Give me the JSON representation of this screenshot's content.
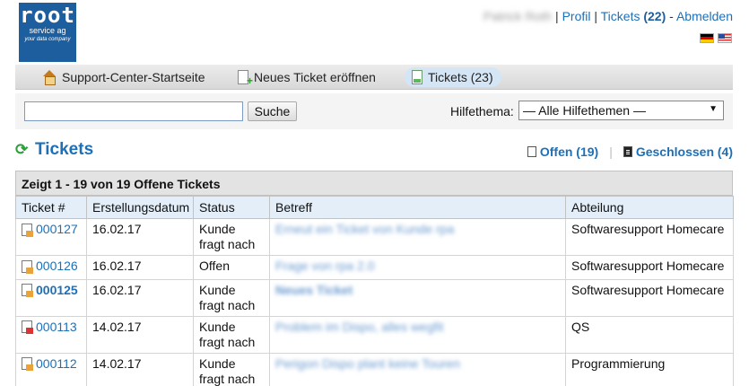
{
  "logo": {
    "line1": "root",
    "line2": "service ag",
    "line3": "your data company"
  },
  "header": {
    "user_name": "Patrick Roth",
    "separator": "|",
    "profile_label": "Profil",
    "tickets_label": "Tickets",
    "tickets_count": "(22)",
    "dash": "-",
    "logout_label": "Abmelden",
    "flags": [
      "flag-de",
      "flag-us"
    ]
  },
  "nav": {
    "tabs": [
      {
        "label": "Support-Center-Startseite",
        "icon": "home-icon"
      },
      {
        "label": "Neues Ticket eröffnen",
        "icon": "new-ticket-icon"
      },
      {
        "label": "Tickets (23)",
        "icon": "tickets-icon",
        "active": true
      }
    ]
  },
  "search": {
    "value": "",
    "button_label": "Suche",
    "help_topic_label": "Hilfethema:",
    "help_topic_value": "— Alle Hilfethemen —"
  },
  "page": {
    "title": "Tickets",
    "open_label": "Offen (19)",
    "closed_label": "Geschlossen (4)",
    "divider": "|"
  },
  "table": {
    "caption": "Zeigt 1 - 19 von 19 Offene Tickets",
    "headers": [
      "Ticket #",
      "Erstellungsdatum",
      "Status",
      "Betreff",
      "Abteilung"
    ],
    "rows": [
      {
        "number": "000127",
        "date": "16.02.17",
        "status": "Kunde fragt nach",
        "subject": "Erneut ein Ticket von Kunde rpa",
        "department": "Softwaresupport Homecare",
        "bold": false
      },
      {
        "number": "000126",
        "date": "16.02.17",
        "status": "Offen",
        "subject": "Frage von rpa 2.0",
        "department": "Softwaresupport Homecare",
        "bold": false
      },
      {
        "number": "000125",
        "date": "16.02.17",
        "status": "Kunde fragt nach",
        "subject": "Neues Ticket",
        "department": "Softwaresupport Homecare",
        "bold": true
      },
      {
        "number": "000113",
        "date": "14.02.17",
        "status": "Kunde fragt nach",
        "subject": "Problem im Dispo, alles wegfit",
        "department": "QS",
        "bold": false
      },
      {
        "number": "000112",
        "date": "14.02.17",
        "status": "Kunde fragt nach",
        "subject": "Perigon Dispo plant keine Touren",
        "department": "Programmierung",
        "bold": false
      }
    ]
  }
}
